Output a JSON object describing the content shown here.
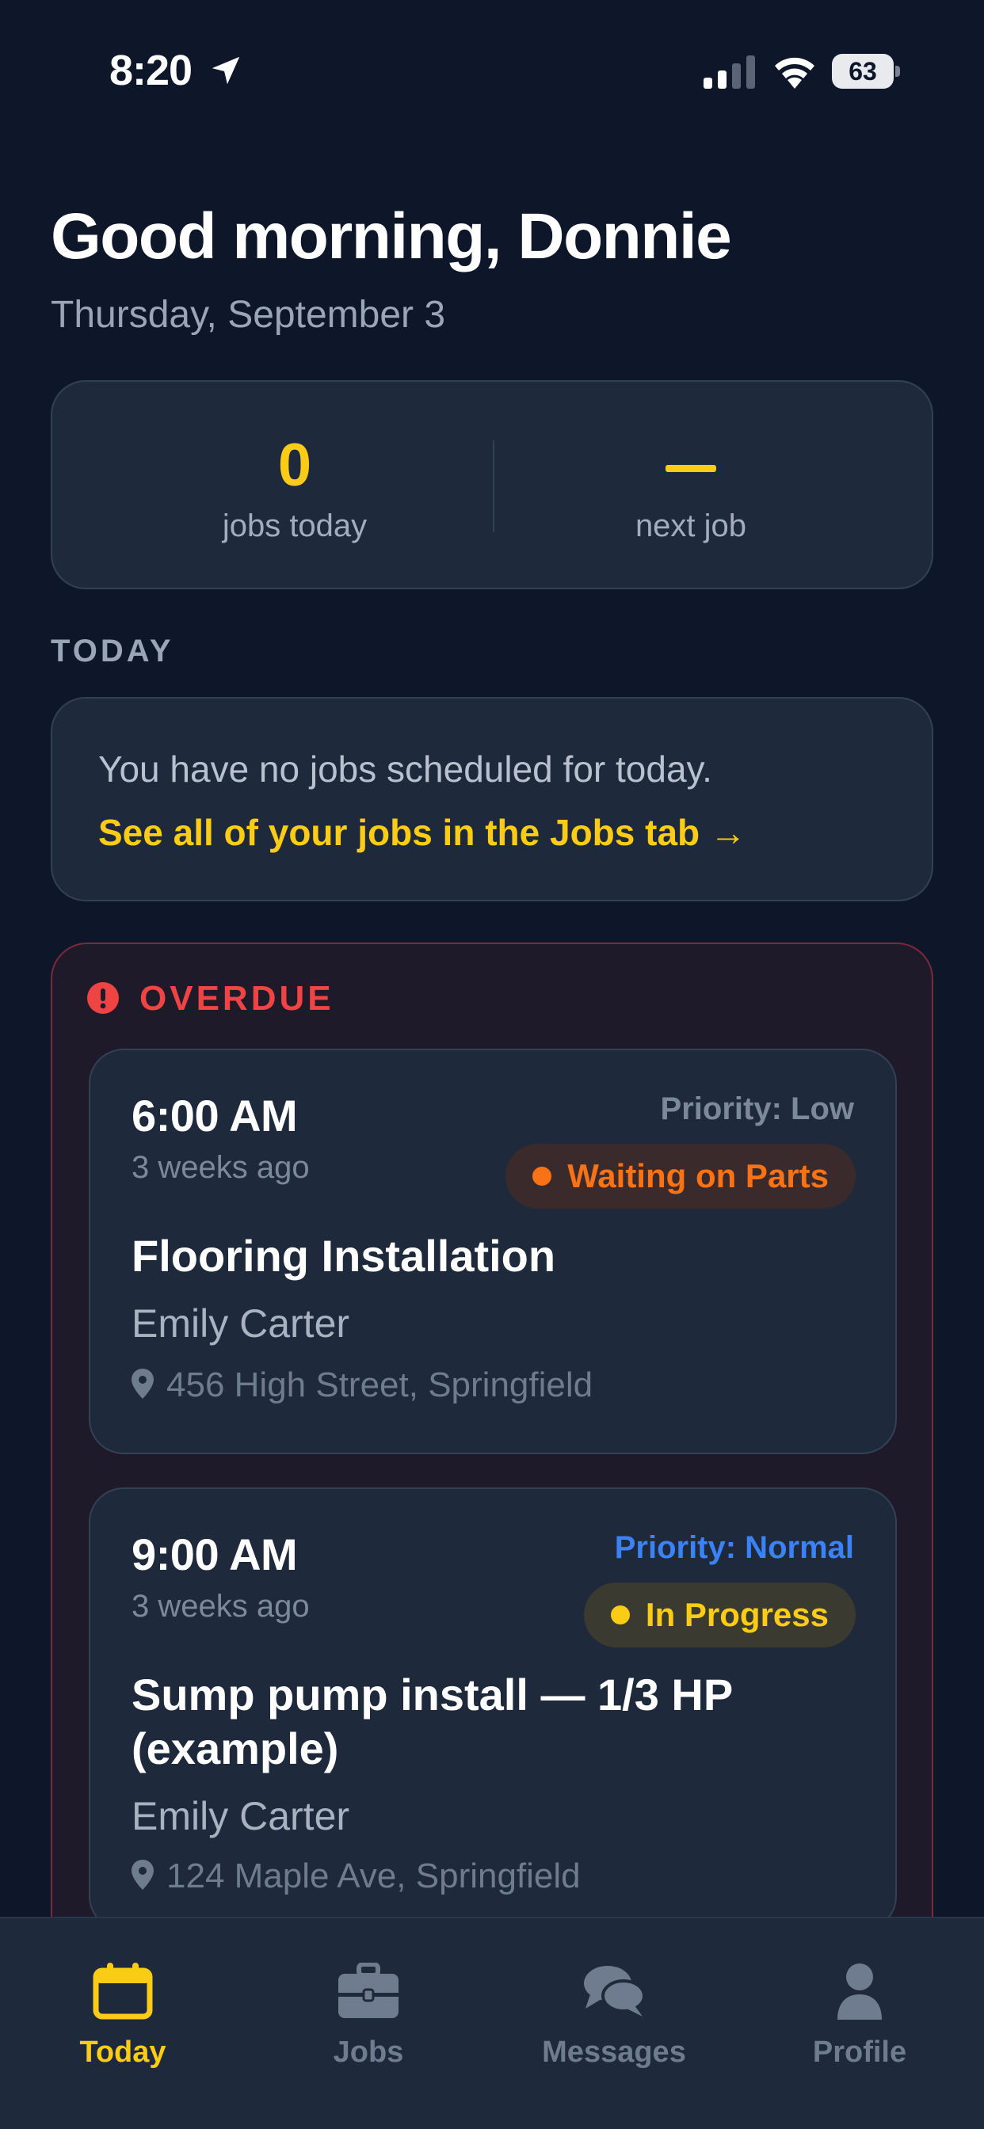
{
  "status_bar": {
    "time": "8:20",
    "battery": "63"
  },
  "header": {
    "greeting": "Good morning, Donnie",
    "date": "Thursday, September 3"
  },
  "summary": {
    "jobs_today_value": "0",
    "jobs_today_label": "jobs today",
    "next_job_label": "next job"
  },
  "today": {
    "section_label": "TODAY",
    "empty_message": "You have no jobs scheduled for today.",
    "jobs_link": "See all of your jobs in the Jobs tab →"
  },
  "overdue": {
    "label": "OVERDUE",
    "jobs": [
      {
        "time": "6:00 AM",
        "ago": "3 weeks ago",
        "priority": "Priority: Low",
        "priority_color": "#7c889b",
        "status": "Waiting on Parts",
        "status_color": "#f97316",
        "status_bg": "#3b2a2c",
        "title": "Flooring Installation",
        "customer": "Emily Carter",
        "address": "456 High Street, Springfield"
      },
      {
        "time": "9:00 AM",
        "ago": "3 weeks ago",
        "priority": "Priority: Normal",
        "priority_color": "#3b82f6",
        "status": "In Progress",
        "status_color": "#facc15",
        "status_bg": "#3a3a30",
        "title": "Sump pump install — 1/3 HP (example)",
        "customer": "Emily Carter",
        "address": "124 Maple Ave, Springfield"
      }
    ]
  },
  "tab_bar": {
    "tabs": [
      {
        "label": "Today",
        "icon": "calendar-icon",
        "active": true
      },
      {
        "label": "Jobs",
        "icon": "briefcase-icon",
        "active": false
      },
      {
        "label": "Messages",
        "icon": "chat-bubbles-icon",
        "active": false
      },
      {
        "label": "Profile",
        "icon": "person-icon",
        "active": false
      }
    ]
  },
  "colors": {
    "background": "#0e1729",
    "card": "#1e293b",
    "accent": "#facc15",
    "overdue": "#ef4444"
  }
}
